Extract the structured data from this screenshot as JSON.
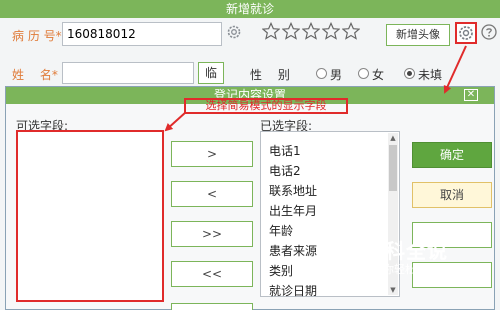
{
  "window": {
    "title": "新增就诊"
  },
  "patient": {
    "mrn_label": "病 历 号*",
    "mrn_value": "160818012",
    "avatar_button": "新增头像",
    "name_label": "姓　 名*",
    "name_button": "临",
    "gender_label": "性　 别",
    "gender_options": [
      "男",
      "女",
      "未填"
    ],
    "gender_selected": "未填",
    "rating_stars": 5
  },
  "dialog": {
    "title": "登记内容设置",
    "hint": "选择简易模式的显示字段",
    "available_label": "可选字段:",
    "selected_label": "已选字段:",
    "selected_fields": [
      "电话1",
      "电话2",
      "联系地址",
      "出生年月",
      "年龄",
      "患者来源",
      "类别",
      "就诊日期"
    ],
    "buttons": {
      "add": ">",
      "remove": "<",
      "add_all": ">>",
      "remove_all": "<<",
      "ok": "确定",
      "cancel": "取消"
    }
  },
  "watermark": {
    "title": "百科全说",
    "subtitle": "助你轻松解决"
  },
  "colors": {
    "titlebar": "#7cb55a",
    "highlight": "#e02b2b",
    "label_orange": "#e07b39",
    "ok": "#5fa63f"
  }
}
